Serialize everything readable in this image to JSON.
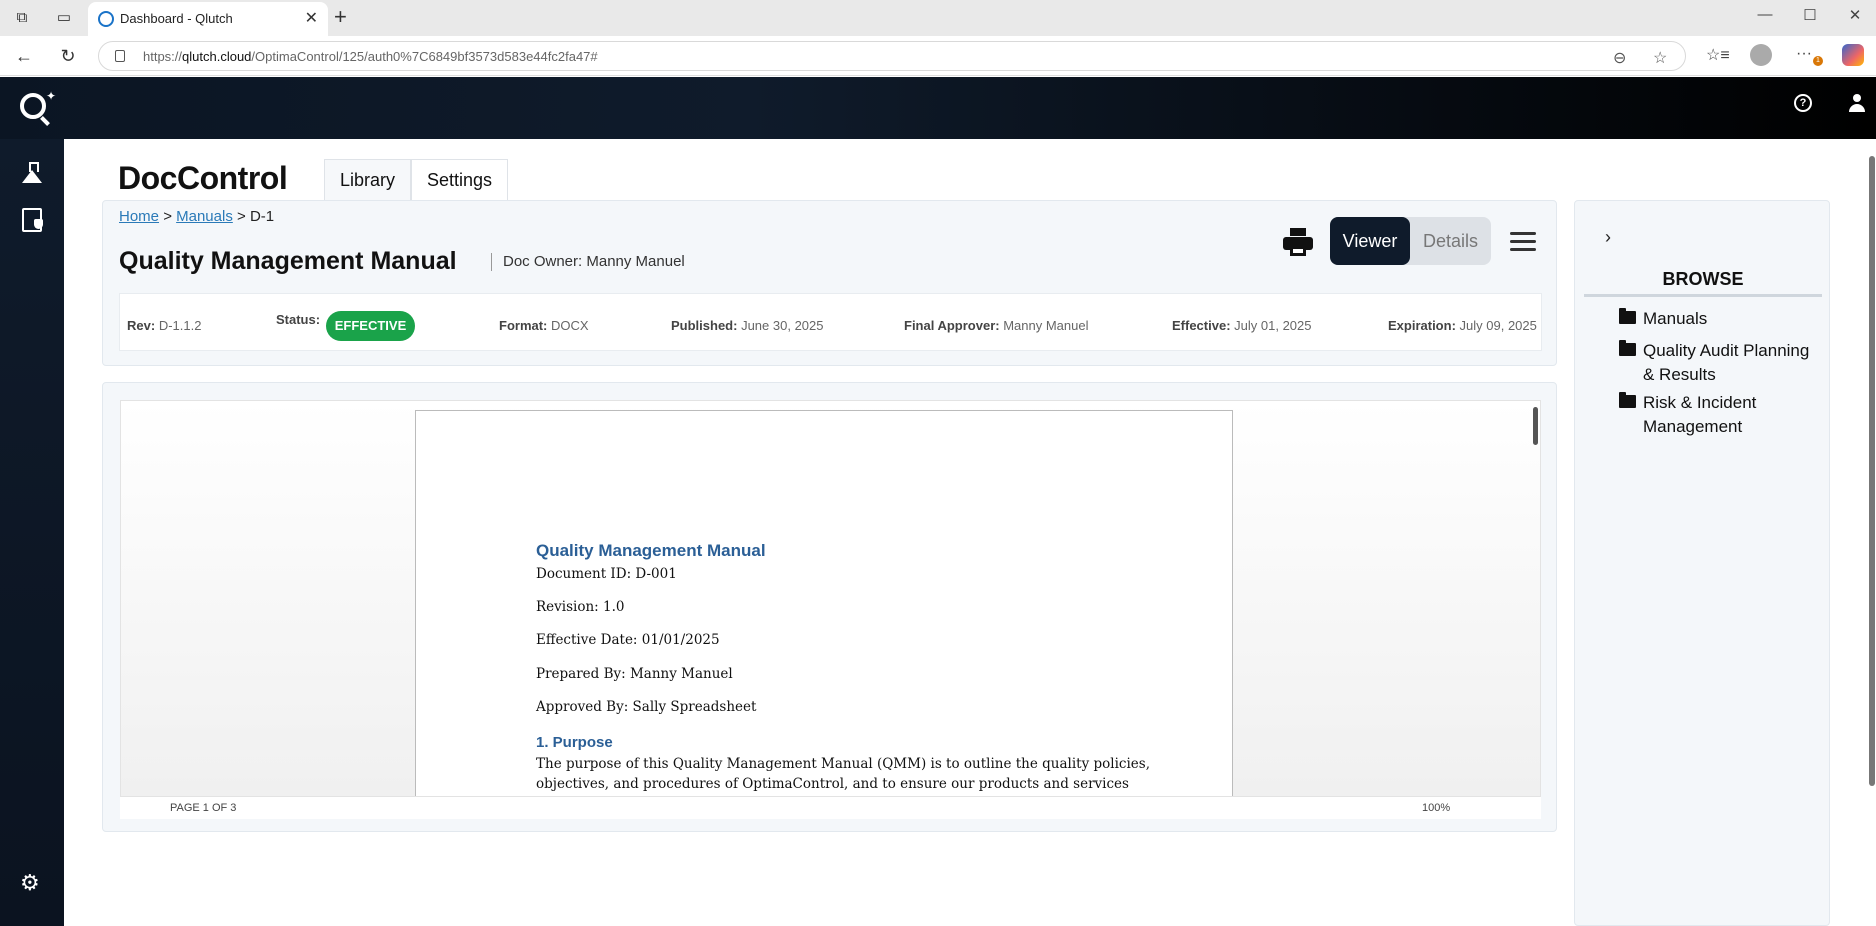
{
  "browser": {
    "tab_title": "Dashboard - Qlutch",
    "url_domain": "qlutch.cloud",
    "url_prefix": "https://",
    "url_path": "/OptimaControl/125/auth0%7C6849bf3573d583e44fc2fa47#",
    "extensions_badge": "1"
  },
  "app": {
    "title": "DocControl",
    "tabs": [
      {
        "label": "Library"
      },
      {
        "label": "Settings"
      }
    ]
  },
  "breadcrumb": {
    "home": "Home",
    "manuals": "Manuals",
    "separator": ">",
    "current": "D-1"
  },
  "document": {
    "title": "Quality Management Manual",
    "owner": "Doc Owner: Manny Manuel",
    "view_toggle": {
      "viewer": "Viewer",
      "details": "Details"
    },
    "meta": {
      "rev_label": "Rev:",
      "rev": "D-1.1.2",
      "status_label": "Status:",
      "status": "EFFECTIVE",
      "format_label": "Format:",
      "format": "DOCX",
      "published_label": "Published:",
      "published": "June 30, 2025",
      "approver_label": "Final Approver:",
      "approver": "Manny Manuel",
      "effective_label": "Effective:",
      "effective": "July 01, 2025",
      "expiration_label": "Expiration:",
      "expiration": "July 09, 2025"
    },
    "status_color": "#1aa34a"
  },
  "viewer": {
    "heading": "Quality Management Manual",
    "lines": [
      "Document ID: D-001",
      "Revision: 1.0",
      "Effective Date: 01/01/2025",
      "Prepared By: Manny Manuel",
      "Approved By: Sally Spreadsheet"
    ],
    "section_title": "1. Purpose",
    "section_body_1": "The purpose of this Quality Management Manual (QMM) is to outline the quality policies,",
    "section_body_2": "objectives, and procedures of OptimaControl, and to ensure our products and services",
    "page_info": "PAGE 1 OF 3",
    "zoom": "100%"
  },
  "browse": {
    "title": "BROWSE",
    "folders": [
      {
        "label": "Manuals"
      },
      {
        "label": "Quality Audit Planning & Results"
      },
      {
        "label": "Risk & Incident Management"
      }
    ]
  },
  "colors": {
    "header_dark": "#0f1b2b",
    "link": "#2a7ab8",
    "doc_heading": "#2b5f96"
  }
}
